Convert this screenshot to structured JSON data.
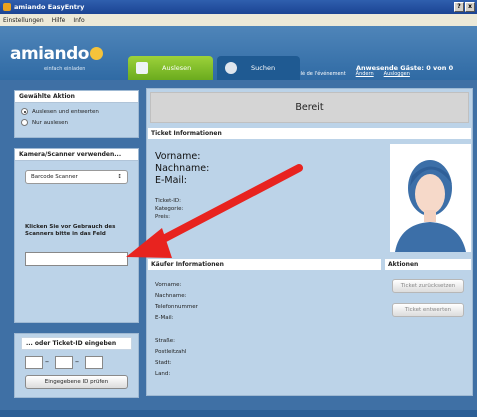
{
  "window": {
    "title": "amiando EasyEntry",
    "buttons": [
      "?",
      "x"
    ]
  },
  "menu": [
    "Einstellungen",
    "Hilfe",
    "Info"
  ],
  "header": {
    "logo": "amiando",
    "tagline": "einfach einladen",
    "event_text": "Event: Inscrire ici l'intitulé de l'événement",
    "change_link": "Ändern",
    "exit_link": "Ausloggen",
    "tabs": [
      {
        "label": "Auslesen"
      },
      {
        "label": "Suchen"
      }
    ],
    "guests": "Anwesende Gäste: 0 von 0"
  },
  "left": {
    "action": {
      "title": "Gewählte Aktion",
      "options": [
        "Auslesen und entwerten",
        "Nur auslesen"
      ],
      "selected": 0
    },
    "camera": {
      "title": "Kamera/Scanner verwenden...",
      "device": "Barcode Scanner",
      "hint": "Klicken Sie vor Gebrauch des Scanners bitte in das Feld",
      "field_value": ""
    },
    "ticket_id": {
      "title": "... oder Ticket-ID eingeben",
      "separator": "–",
      "check_button": "Eingegebene ID prüfen"
    }
  },
  "main": {
    "status": "Bereit",
    "ticket_info": {
      "title": "Ticket Informationen",
      "big_labels": [
        "Vorname:",
        "Nachname:",
        "E-Mail:"
      ],
      "small_labels": [
        "Ticket-ID:",
        "Kategorie:",
        "Preis:"
      ]
    },
    "buyer_info": {
      "title": "Käufer Informationen",
      "labels": [
        "Vorname:",
        "Nachname:",
        "Telefonnummer",
        "E-Mail:",
        "Straße:",
        "Postleitzahl",
        "Stadt:",
        "Land:"
      ]
    },
    "actions": {
      "title": "Aktionen",
      "buttons": [
        "Ticket zurücksetzen",
        "Ticket entwerten"
      ]
    }
  },
  "colors": {
    "accent": "#7cbf2a",
    "header": "#3f74ab",
    "panel": "#bcd3e8",
    "arrow": "#e8231f"
  }
}
